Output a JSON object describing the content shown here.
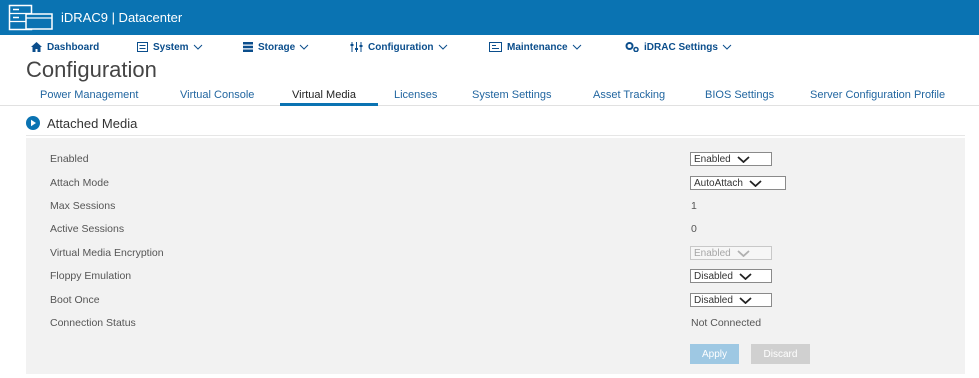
{
  "app": {
    "title": "iDRAC9 | Datacenter"
  },
  "menu": [
    {
      "label": "Dashboard",
      "icon": "home-icon"
    },
    {
      "label": "System",
      "icon": "system-icon"
    },
    {
      "label": "Storage",
      "icon": "storage-icon"
    },
    {
      "label": "Configuration",
      "icon": "configuration-icon"
    },
    {
      "label": "Maintenance",
      "icon": "maintenance-icon"
    },
    {
      "label": "iDRAC Settings",
      "icon": "idrac-settings-icon"
    }
  ],
  "page": {
    "title": "Configuration"
  },
  "tabs": [
    {
      "label": "Power Management"
    },
    {
      "label": "Virtual Console"
    },
    {
      "label": "Virtual Media",
      "active": true
    },
    {
      "label": "Licenses"
    },
    {
      "label": "System Settings"
    },
    {
      "label": "Asset Tracking"
    },
    {
      "label": "BIOS Settings"
    },
    {
      "label": "Server Configuration Profile"
    }
  ],
  "section": {
    "title": "Attached Media"
  },
  "settings": {
    "enabled": {
      "label": "Enabled",
      "value": "Enabled"
    },
    "attach_mode": {
      "label": "Attach Mode",
      "value": "AutoAttach"
    },
    "max_sessions": {
      "label": "Max Sessions",
      "value": "1"
    },
    "active_sessions": {
      "label": "Active Sessions",
      "value": "0"
    },
    "encryption": {
      "label": "Virtual Media Encryption",
      "value": "Enabled"
    },
    "floppy": {
      "label": "Floppy Emulation",
      "value": "Disabled"
    },
    "boot_once": {
      "label": "Boot Once",
      "value": "Disabled"
    },
    "connection": {
      "label": "Connection Status",
      "value": "Not Connected"
    }
  },
  "buttons": {
    "apply": "Apply",
    "discard": "Discard"
  },
  "colors": {
    "brand": "#0a73b2",
    "menu_text": "#0b4e8c",
    "panel": "#f2f2f2"
  }
}
